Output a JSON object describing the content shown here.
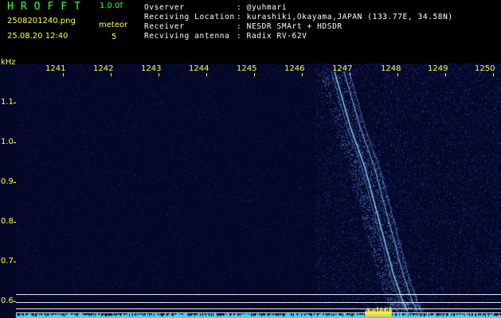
{
  "app": {
    "name": "HROFFT",
    "version": "1.0.0f"
  },
  "file": {
    "name": "2508201240.png",
    "datetime": "25.08.20 12:40"
  },
  "mode": {
    "label": "meteor",
    "value": "5"
  },
  "info": [
    {
      "label": "Ovserver",
      "value": ": @yuhmari"
    },
    {
      "label": "Receiving Location",
      "value": ": kurashiki,Okayama,JAPAN (133.77E, 34.58N)"
    },
    {
      "label": "Receiver",
      "value": ": NESDR SMArt + HDSDR"
    },
    {
      "label": "Recviving antenna",
      "value": ": Radix RV-62V"
    }
  ],
  "spectrogram": {
    "y_unit": "kHz",
    "freq_ticks": [
      "1241",
      "1242",
      "1243",
      "1244",
      "1245",
      "1246",
      "1247",
      "1248",
      "1249",
      "1250"
    ],
    "y_ticks": [
      "1.1",
      "1.0",
      "0.9",
      "0.8",
      "0.7",
      "0.6"
    ],
    "colors": {
      "background": "#040826",
      "noise": "#2a3fd0",
      "echo": "#8fe8ff",
      "baseline": "#30e0ff",
      "burst": "#ffe000"
    }
  }
}
